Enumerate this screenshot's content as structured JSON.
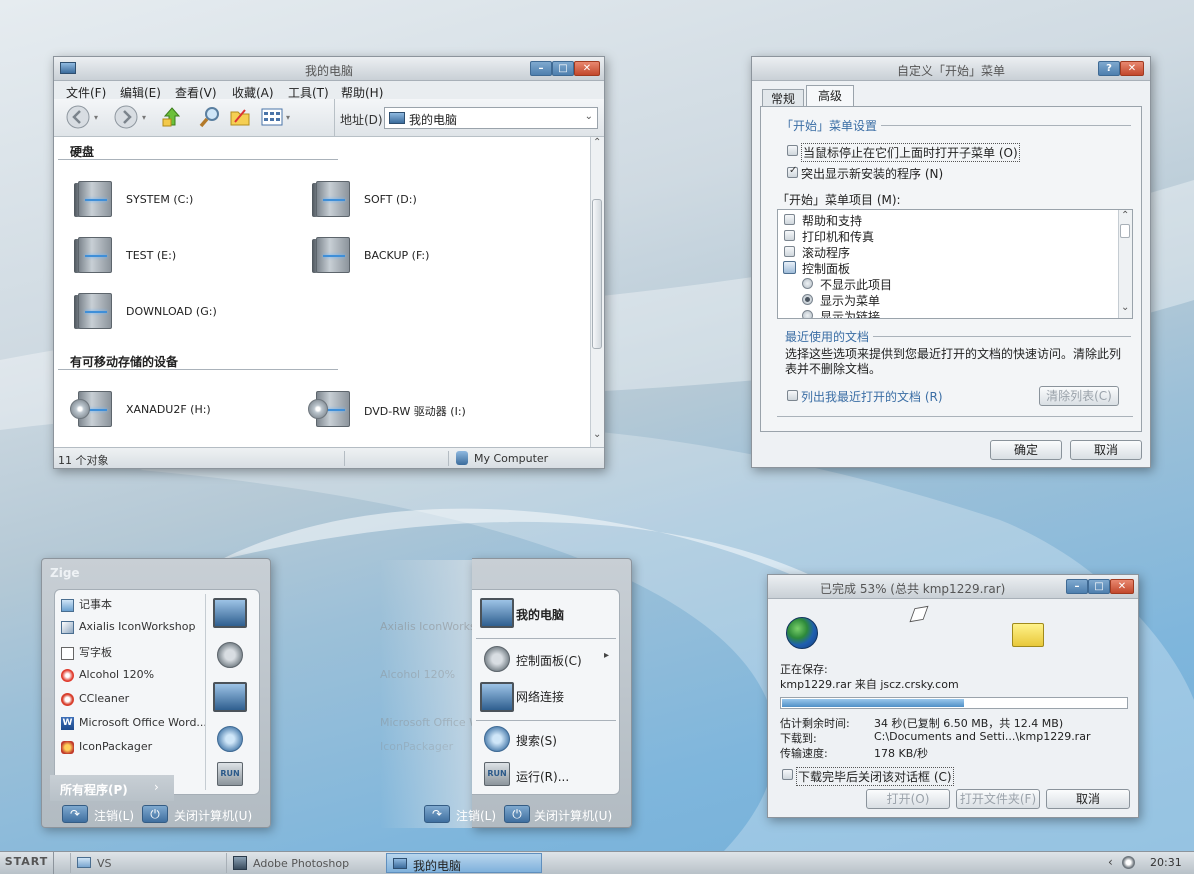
{
  "colors": {
    "accent": "#4e7fae",
    "close": "#c2482c",
    "progress": "#5f9fd2"
  },
  "mycomputer": {
    "title": "我的电脑",
    "menu": [
      "文件(F)",
      "编辑(E)",
      "查看(V)",
      "收藏(A)",
      "工具(T)",
      "帮助(H)"
    ],
    "toolbar_icons": [
      "back-icon",
      "forward-icon",
      "up-folder-icon",
      "search-icon",
      "folders-icon",
      "views-icon"
    ],
    "address_label": "地址(D)",
    "address_value": "我的电脑",
    "section_hdd": "硬盘",
    "section_removable": "有可移动存储的设备",
    "drives": [
      "SYSTEM (C:)",
      "SOFT (D:)",
      "TEST (E:)",
      "BACKUP (F:)",
      "DOWNLOAD (G:)"
    ],
    "removable": [
      "XANADU2F (H:)",
      "DVD-RW 驱动器 (I:)"
    ],
    "status_left": "11 个对象",
    "status_right": "My Computer"
  },
  "startdlg": {
    "title": "自定义「开始」菜单",
    "tabs": [
      "常规",
      "高级"
    ],
    "group_settings": "「开始」菜单设置",
    "opt_hover": "当鼠标停止在它们上面时打开子菜单 (O)",
    "opt_highlight": "突出显示新安装的程序 (N)",
    "items_label": "「开始」菜单项目 (M):",
    "items": [
      "帮助和支持",
      "打印机和传真",
      "滚动程序",
      "控制面板",
      "不显示此项目",
      "显示为菜单",
      "显示为链接"
    ],
    "recent_title": "最近使用的文档",
    "recent_desc": "选择这些选项来提供到您最近打开的文档的快速访问。清除此列表并不删除文档。",
    "recent_opt": "列出我最近打开的文档 (R)",
    "clear_button": "清除列表(C)",
    "ok": "确定",
    "cancel": "取消"
  },
  "startmenu": {
    "user": "Zige",
    "left_items": [
      "记事本",
      "Axialis IconWorkshop",
      "写字板",
      "Alcohol 120%",
      "CCleaner",
      "Microsoft Office Word...",
      "IconPackager"
    ],
    "all_programs": "所有程序(P)",
    "right_items": [
      "我的电脑",
      "控制面板(C)",
      "网络连接",
      "搜索(S)",
      "运行(R)..."
    ],
    "logoff": "注销(L)",
    "shutdown": "关闭计算机(U)",
    "ghost_items": [
      "Axialis IconWorkshop",
      "Alcohol 120%",
      "Microsoft Office Word...",
      "IconPackager"
    ]
  },
  "download": {
    "title": "已完成 53% (总共 kmp1229.rar)",
    "saving": "正在保存:",
    "file_from": "kmp1229.rar 来自 jscz.crsky.com",
    "progress": 0.53,
    "est_label": "估计剩余时间:",
    "est_value": "34 秒(已复制 6.50 MB，共 12.4 MB)",
    "dl_to_label": "下载到:",
    "dl_to_value": "C:\\Documents and Setti...\\kmp1229.rar",
    "rate_label": "传输速度:",
    "rate_value": "178 KB/秒",
    "close_opt": "下载完毕后关闭该对话框 (C)",
    "btn_open": "打开(O)",
    "btn_open_folder": "打开文件夹(F)",
    "btn_cancel": "取消"
  },
  "taskbar": {
    "start": "START",
    "tasks": [
      "VS",
      "Adobe Photoshop",
      "我的电脑"
    ],
    "clock": "20:31"
  }
}
